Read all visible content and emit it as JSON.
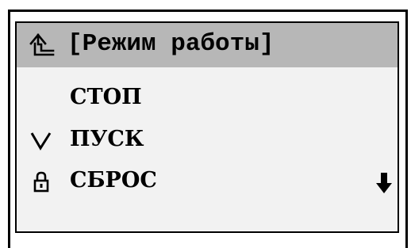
{
  "screen": {
    "title": "[Режим работы]",
    "title_icon": "back-arrow-icon",
    "menu_items": [
      {
        "label": "СТОП",
        "marker": ""
      },
      {
        "label": "ПУСК",
        "marker": "selected-check-icon"
      },
      {
        "label": "СБРОС",
        "marker": "lock-icon"
      }
    ],
    "scroll_indicator": "scroll-down-arrow-icon"
  }
}
